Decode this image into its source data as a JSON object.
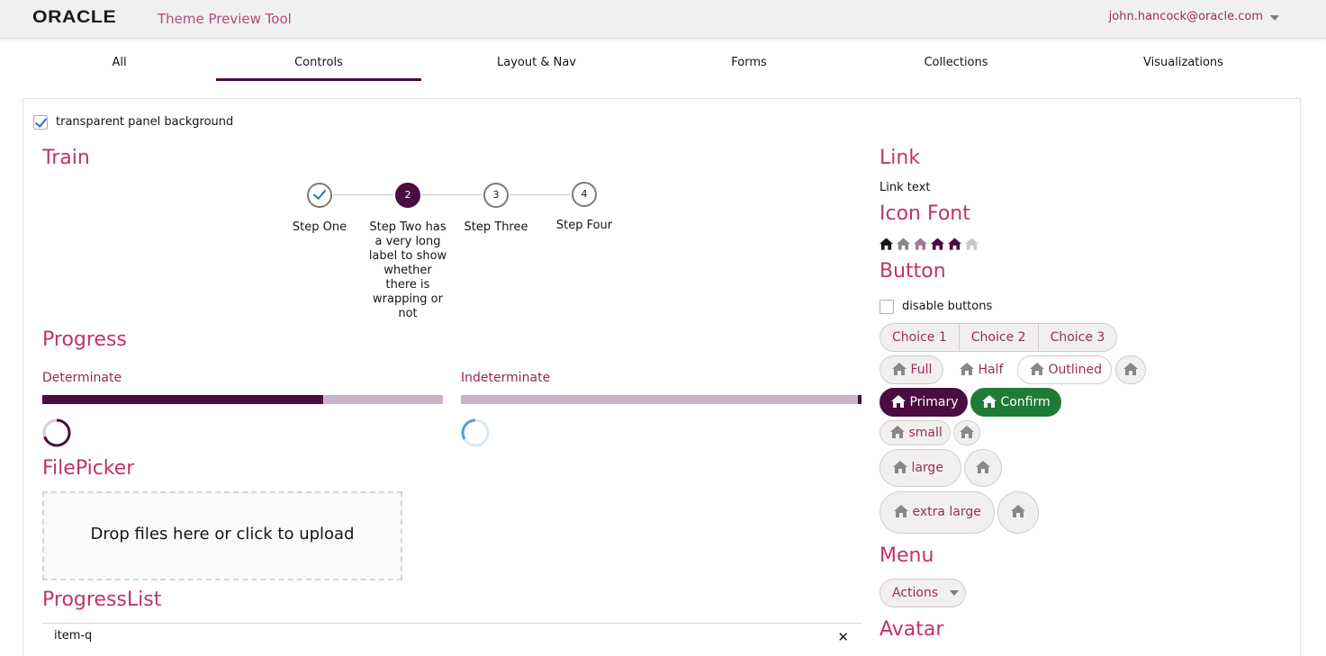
{
  "header": {
    "logo": "ORACLE",
    "app_title": "Theme Preview Tool",
    "user_email": "john.hancock@oracle.com"
  },
  "tabs": [
    {
      "label": "All",
      "active": false
    },
    {
      "label": "Controls",
      "active": true
    },
    {
      "label": "Layout & Nav",
      "active": false
    },
    {
      "label": "Forms",
      "active": false
    },
    {
      "label": "Collections",
      "active": false
    },
    {
      "label": "Visualizations",
      "active": false
    }
  ],
  "panel": {
    "transparent_checkbox_label": "transparent panel background",
    "transparent_checked": true
  },
  "train": {
    "heading": "Train",
    "steps": [
      {
        "number": "",
        "label": "Step One",
        "state": "done"
      },
      {
        "number": "2",
        "label": "Step Two has a very long label to show whether there is wrapping or not",
        "state": "current"
      },
      {
        "number": "3",
        "label": "Step Three",
        "state": "pending"
      },
      {
        "number": "4",
        "label": "Step Four",
        "state": "pending"
      }
    ]
  },
  "progress": {
    "heading": "Progress",
    "determinate_label": "Determinate",
    "determinate_value": 0.7,
    "indeterminate_label": "Indeterminate"
  },
  "filepicker": {
    "heading": "FilePicker",
    "drop_text": "Drop files here or click to upload"
  },
  "progresslist": {
    "heading": "ProgressList",
    "items": [
      {
        "name": "item-q"
      }
    ]
  },
  "link": {
    "heading": "Link",
    "text": "Link text"
  },
  "iconfont": {
    "heading": "Icon Font",
    "colors": [
      "#161513",
      "#8a8886",
      "#a67a95",
      "#4a0d40",
      "#4a0d40",
      "#c9c7c5"
    ]
  },
  "button": {
    "heading": "Button",
    "disable_label": "disable buttons",
    "disable_checked": false,
    "choices": [
      "Choice 1",
      "Choice 2",
      "Choice 3"
    ],
    "full": "Full",
    "half": "Half",
    "outlined": "Outlined",
    "primary": "Primary",
    "confirm": "Confirm",
    "small": "small",
    "large": "large",
    "extra_large": "extra large"
  },
  "menu": {
    "heading": "Menu",
    "button": "Actions"
  },
  "avatar": {
    "heading": "Avatar"
  },
  "colors": {
    "accent": "#4a0d40",
    "heading": "#c0336b",
    "confirm": "#1f7a35"
  }
}
